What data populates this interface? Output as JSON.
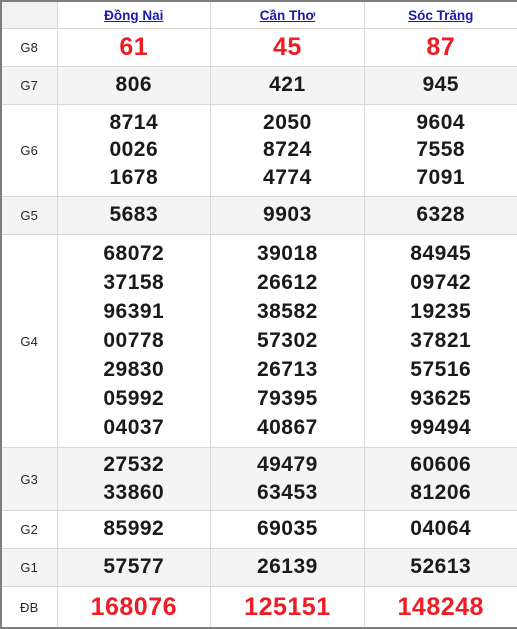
{
  "table": {
    "header": {
      "corner_label": "",
      "provinces": [
        {
          "name": "Đồng Nai",
          "icon": "link-text"
        },
        {
          "name": "Cần Thơ",
          "icon": "link-text"
        },
        {
          "name": "Sóc Trăng",
          "icon": "link-text"
        }
      ]
    },
    "colors": {
      "link": "#1a1aad",
      "highlight": "#ee1c25",
      "text": "#1a1a1a",
      "header_bg": "#f1f1f1",
      "shade_bg": "#f4f4f4",
      "border": "#dcd7d2",
      "frame": "#7d7d7d"
    },
    "rows": [
      {
        "label": "G8",
        "highlight": true,
        "shaded": false,
        "dong_nai": [
          "61"
        ],
        "can_tho": [
          "45"
        ],
        "soc_trang": [
          "87"
        ]
      },
      {
        "label": "G7",
        "highlight": false,
        "shaded": true,
        "dong_nai": [
          "806"
        ],
        "can_tho": [
          "421"
        ],
        "soc_trang": [
          "945"
        ]
      },
      {
        "label": "G6",
        "highlight": false,
        "shaded": false,
        "dong_nai": [
          "8714",
          "0026",
          "1678"
        ],
        "can_tho": [
          "2050",
          "8724",
          "4774"
        ],
        "soc_trang": [
          "9604",
          "7558",
          "7091"
        ]
      },
      {
        "label": "G5",
        "highlight": false,
        "shaded": true,
        "dong_nai": [
          "5683"
        ],
        "can_tho": [
          "9903"
        ],
        "soc_trang": [
          "6328"
        ]
      },
      {
        "label": "G4",
        "highlight": false,
        "shaded": false,
        "dong_nai": [
          "68072",
          "37158",
          "96391",
          "00778",
          "29830",
          "05992",
          "04037"
        ],
        "can_tho": [
          "39018",
          "26612",
          "38582",
          "57302",
          "26713",
          "79395",
          "40867"
        ],
        "soc_trang": [
          "84945",
          "09742",
          "19235",
          "37821",
          "57516",
          "93625",
          "99494"
        ]
      },
      {
        "label": "G3",
        "highlight": false,
        "shaded": true,
        "dong_nai": [
          "27532",
          "33860"
        ],
        "can_tho": [
          "49479",
          "63453"
        ],
        "soc_trang": [
          "60606",
          "81206"
        ]
      },
      {
        "label": "G2",
        "highlight": false,
        "shaded": false,
        "dong_nai": [
          "85992"
        ],
        "can_tho": [
          "69035"
        ],
        "soc_trang": [
          "04064"
        ]
      },
      {
        "label": "G1",
        "highlight": false,
        "shaded": true,
        "dong_nai": [
          "57577"
        ],
        "can_tho": [
          "26139"
        ],
        "soc_trang": [
          "52613"
        ]
      },
      {
        "label": "ĐB",
        "highlight": true,
        "shaded": false,
        "dong_nai": [
          "168076"
        ],
        "can_tho": [
          "125151"
        ],
        "soc_trang": [
          "148248"
        ]
      }
    ]
  }
}
